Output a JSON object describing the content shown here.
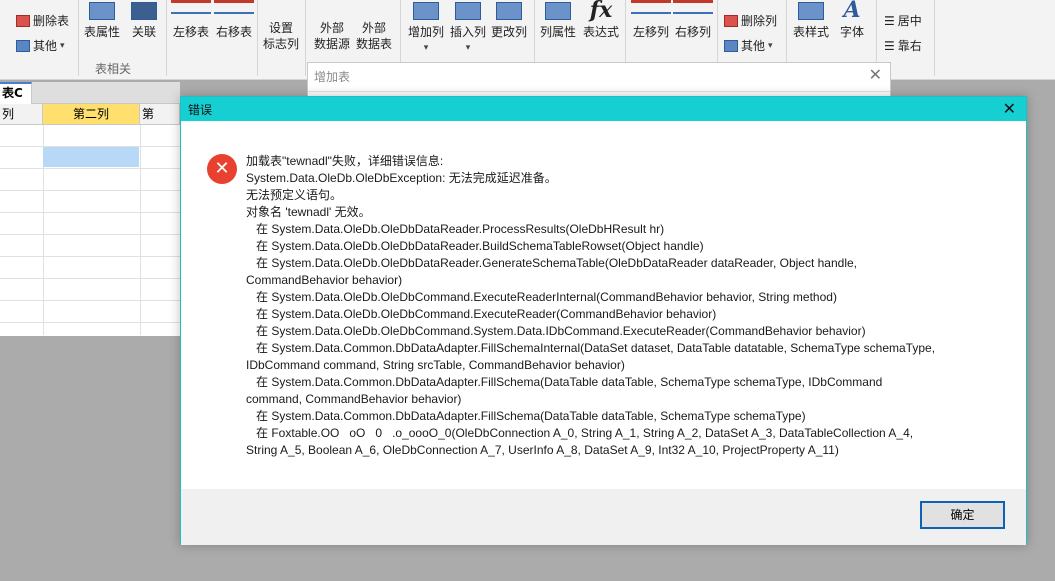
{
  "ribbon": {
    "delete_table": "删除表",
    "other_left": "其他",
    "table_props": "表属性",
    "relation": "关联",
    "group_table_related": "表相关",
    "move_table_left": "左移表",
    "move_table_right": "右移表",
    "set_title_col_line1": "设置",
    "set_title_col_line2": "标志列",
    "ext_datasource_line1": "外部",
    "ext_datasource_line2": "数据源",
    "ext_datatable_line1": "外部",
    "ext_datatable_line2": "数据表",
    "add_column": "增加列",
    "insert_column": "插入列",
    "change_column": "更改列",
    "column_props": "列属性",
    "expression": "表达式",
    "fx_symbol": "fx",
    "move_col_left": "左移列",
    "move_col_right": "右移列",
    "delete_column": "删除列",
    "other_right": "其他",
    "table_style": "表样式",
    "font": "字体",
    "font_glyph": "A",
    "align_center": "居中",
    "align_right": "靠右"
  },
  "sheet": {
    "tab_label": "表C",
    "col_partial_left": "列",
    "col_second": "第二列",
    "col_partial_right": "第"
  },
  "bg_dialog": {
    "title": "增加表",
    "close": "✕"
  },
  "error_dialog": {
    "title": "错误",
    "close": "✕",
    "icon": "✕",
    "message": "加载表\"tewnadl\"失败，详细错误信息:\nSystem.Data.OleDb.OleDbException: 无法完成延迟准备。\n无法预定义语句。\n对象名 'tewnadl' 无效。\n   在 System.Data.OleDb.OleDbDataReader.ProcessResults(OleDbHResult hr)\n   在 System.Data.OleDb.OleDbDataReader.BuildSchemaTableRowset(Object handle)\n   在 System.Data.OleDb.OleDbDataReader.GenerateSchemaTable(OleDbDataReader dataReader, Object handle,\nCommandBehavior behavior)\n   在 System.Data.OleDb.OleDbCommand.ExecuteReaderInternal(CommandBehavior behavior, String method)\n   在 System.Data.OleDb.OleDbCommand.ExecuteReader(CommandBehavior behavior)\n   在 System.Data.OleDb.OleDbCommand.System.Data.IDbCommand.ExecuteReader(CommandBehavior behavior)\n   在 System.Data.Common.DbDataAdapter.FillSchemaInternal(DataSet dataset, DataTable datatable, SchemaType schemaType,\nIDbCommand command, String srcTable, CommandBehavior behavior)\n   在 System.Data.Common.DbDataAdapter.FillSchema(DataTable dataTable, SchemaType schemaType, IDbCommand\ncommand, CommandBehavior behavior)\n   在 System.Data.Common.DbDataAdapter.FillSchema(DataTable dataTable, SchemaType schemaType)\n   在 Foxtable.OO   oO   0   .o_oooO_0(OleDbConnection A_0, String A_1, String A_2, DataSet A_3, DataTableCollection A_4,\nString A_5, Boolean A_6, OleDbConnection A_7, UserInfo A_8, DataSet A_9, Int32 A_10, ProjectProperty A_11)",
    "ok_label": "确定"
  },
  "colors": {
    "title_bar": "#16cfd3",
    "error_icon": "#e8412f",
    "selected_header": "#ffdf6d",
    "selected_cell": "#b8d8f8",
    "ok_border": "#0c63b5"
  }
}
